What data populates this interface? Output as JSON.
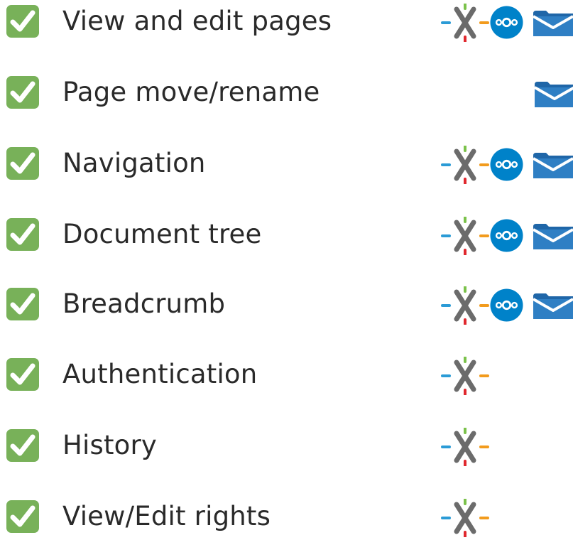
{
  "features": [
    {
      "label": "View and edit pages",
      "check_icon": "check-mark-button-icon",
      "integrations": [
        "xwiki-logo-icon",
        "nextcloud-logo-icon",
        "folder-icon"
      ]
    },
    {
      "label": "Page move/rename",
      "check_icon": "check-mark-button-icon",
      "integrations": [
        "folder-icon"
      ]
    },
    {
      "label": "Navigation",
      "check_icon": "check-mark-button-icon",
      "integrations": [
        "xwiki-logo-icon",
        "nextcloud-logo-icon",
        "folder-icon"
      ]
    },
    {
      "label": "Document tree",
      "check_icon": "check-mark-button-icon",
      "integrations": [
        "xwiki-logo-icon",
        "nextcloud-logo-icon",
        "folder-icon"
      ]
    },
    {
      "label": "Breadcrumb",
      "check_icon": "check-mark-button-icon",
      "integrations": [
        "xwiki-logo-icon",
        "nextcloud-logo-icon",
        "folder-icon"
      ]
    },
    {
      "label": "Authentication",
      "check_icon": "check-mark-button-icon",
      "integrations": [
        "xwiki-logo-icon"
      ]
    },
    {
      "label": "History",
      "check_icon": "check-mark-button-icon",
      "integrations": [
        "xwiki-logo-icon"
      ]
    },
    {
      "label": "View/Edit rights",
      "check_icon": "check-mark-button-icon",
      "integrations": [
        "xwiki-logo-icon"
      ]
    }
  ],
  "colors": {
    "check_green": "#78b159",
    "text": "#2a2a2a",
    "nextcloud_blue": "#0082c9",
    "folder_blue": "#2f7fc4",
    "xwiki_gray": "#6b6b6b",
    "xwiki_blue": "#2b9bd6",
    "xwiki_green": "#7bc24b",
    "xwiki_orange": "#f29b1d",
    "xwiki_red": "#e0282e"
  }
}
